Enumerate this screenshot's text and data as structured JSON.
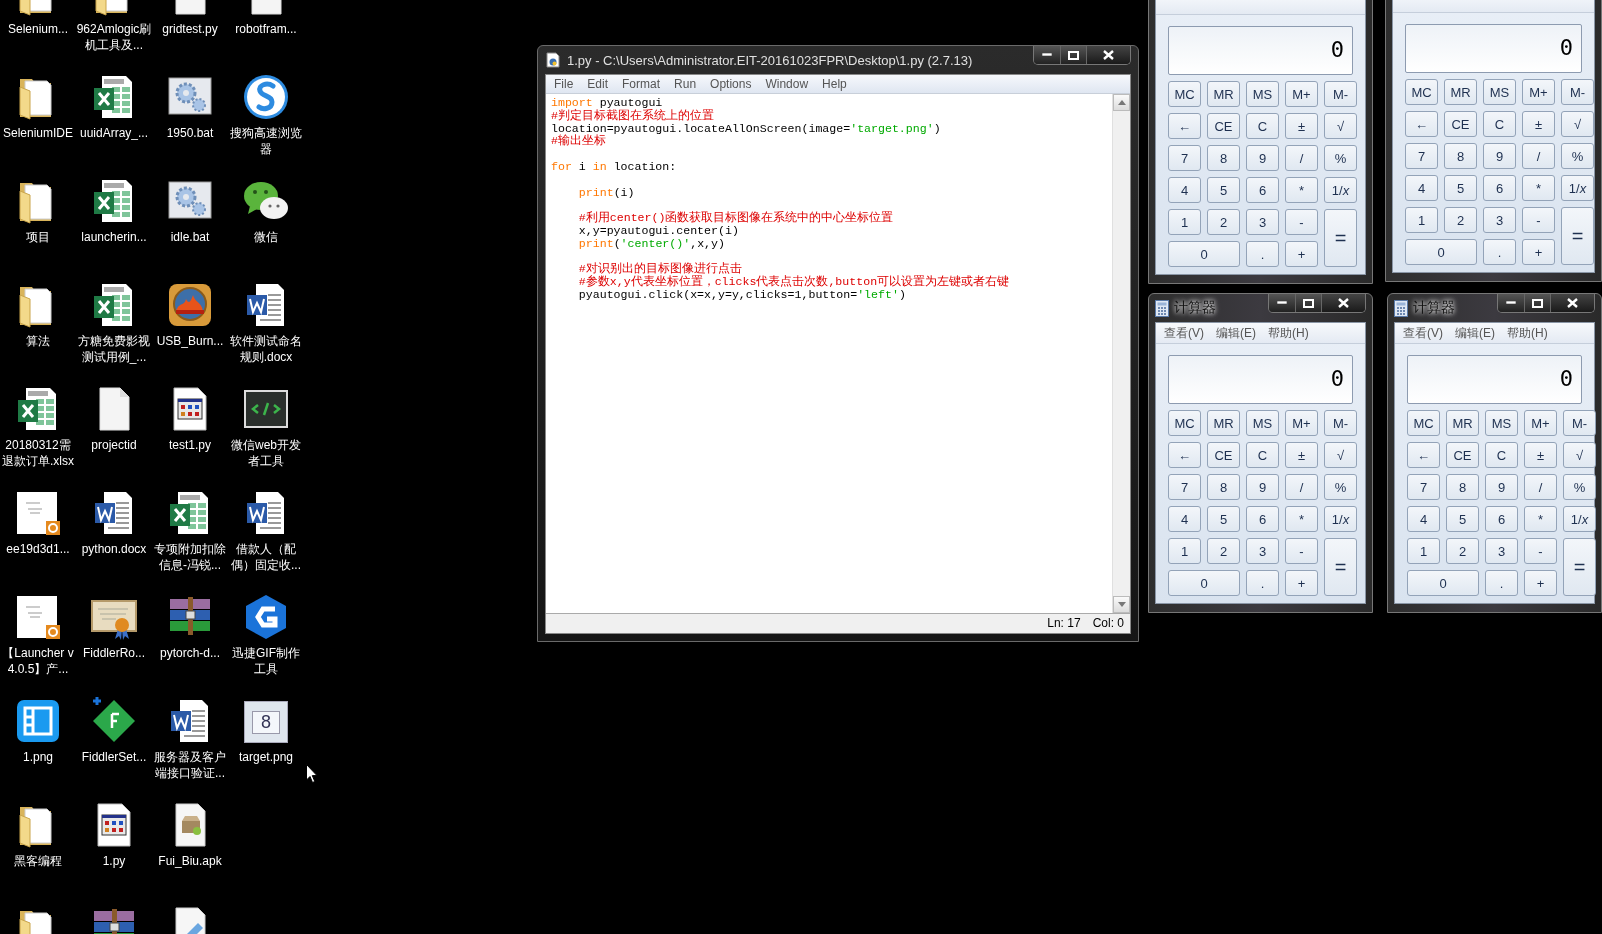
{
  "desktop_icons": [
    {
      "kind": "folder",
      "label": "Selenium..."
    },
    {
      "kind": "folder",
      "label": "SeleniumIDE"
    },
    {
      "kind": "folder",
      "label": "项目"
    },
    {
      "kind": "folder",
      "label": "算法"
    },
    {
      "kind": "spreadsheet",
      "label": "20180312需退款订单.xlsx"
    },
    {
      "kind": "pdfdoc",
      "label": "ee19d3d1..."
    },
    {
      "kind": "pdfdoc",
      "label": "【Launcher v4.0.5】产..."
    },
    {
      "kind": "film",
      "label": "1.png"
    },
    {
      "kind": "folder",
      "label": "黑客编程"
    },
    {
      "kind": "folder"
    },
    {
      "kind": "folder",
      "label": "962Amlogic刷机工具及..."
    },
    {
      "kind": "spreadsheet",
      "label": "uuidArray_..."
    },
    {
      "kind": "spreadsheet",
      "label": "launcherin..."
    },
    {
      "kind": "spreadsheet",
      "label": "方糖免费影视测试用例_..."
    },
    {
      "kind": "blank",
      "label": "projectid"
    },
    {
      "kind": "word",
      "label": "python.docx"
    },
    {
      "kind": "certificate",
      "label": "FiddlerRo..."
    },
    {
      "kind": "fiddler",
      "label": "FiddlerSet..."
    },
    {
      "kind": "script",
      "label": "1.py"
    },
    {
      "kind": "archive"
    },
    {
      "kind": "blank",
      "label": "gridtest.py"
    },
    {
      "kind": "batch",
      "label": "1950.bat"
    },
    {
      "kind": "batch",
      "label": "idle.bat"
    },
    {
      "kind": "usb",
      "label": "USB_Burn..."
    },
    {
      "kind": "script",
      "label": "test1.py"
    },
    {
      "kind": "spreadsheet",
      "label": "专项附加扣除信息-冯锐..."
    },
    {
      "kind": "archive",
      "label": "pytorch-d..."
    },
    {
      "kind": "word",
      "label": "服务器及客户端接口验证..."
    },
    {
      "kind": "apk",
      "label": "Fui_Biu.apk"
    },
    {
      "kind": "notepad"
    },
    {
      "kind": "blank",
      "label": "robotfram..."
    },
    {
      "kind": "browser",
      "label": "搜狗高速浏览器"
    },
    {
      "kind": "chat",
      "label": "微信"
    },
    {
      "kind": "word",
      "label": "软件测试命名规则.docx"
    },
    {
      "kind": "devtools",
      "label": "微信web开发者工具"
    },
    {
      "kind": "word",
      "label": "借款人（配偶）固定收..."
    },
    {
      "kind": "gifmaker",
      "label": "迅捷GIF制作工具"
    },
    {
      "kind": "thumbnail",
      "label": "target.png",
      "image_text": "8"
    }
  ],
  "editor_window": {
    "title": "1.py - C:\\Users\\Administrator.EIT-20161023FPR\\Desktop\\1.py (2.7.13)",
    "menu": [
      "File",
      "Edit",
      "Format",
      "Run",
      "Options",
      "Window",
      "Help"
    ],
    "code_lines": [
      {
        "kind": "code",
        "segments": [
          {
            "kind": "keyword",
            "text": "import"
          },
          {
            "kind": "plain",
            "text": " pyautogui"
          }
        ]
      },
      {
        "kind": "code",
        "segments": [
          {
            "kind": "comment",
            "text": "#判定目标截图在系统上的位置"
          }
        ]
      },
      {
        "kind": "code",
        "segments": [
          {
            "kind": "plain",
            "text": "location=pyautogui.locateAllOnScreen(image="
          },
          {
            "kind": "string",
            "text": "'target.png'"
          },
          {
            "kind": "plain",
            "text": ")"
          }
        ]
      },
      {
        "kind": "code",
        "segments": [
          {
            "kind": "comment",
            "text": "#输出坐标"
          }
        ]
      },
      {
        "kind": "blank"
      },
      {
        "kind": "code",
        "segments": [
          {
            "kind": "keyword",
            "text": "for"
          },
          {
            "kind": "plain",
            "text": " i "
          },
          {
            "kind": "keyword",
            "text": "in"
          },
          {
            "kind": "plain",
            "text": " location:"
          }
        ]
      },
      {
        "kind": "blank"
      },
      {
        "kind": "code",
        "indent": true,
        "segments": [
          {
            "kind": "keyword",
            "text": "print"
          },
          {
            "kind": "plain",
            "text": "(i)"
          }
        ]
      },
      {
        "kind": "blank"
      },
      {
        "kind": "code",
        "indent": true,
        "segments": [
          {
            "kind": "comment",
            "text": "#利用center()函数获取目标图像在系统中的中心坐标位置"
          }
        ]
      },
      {
        "kind": "code",
        "indent": true,
        "segments": [
          {
            "kind": "plain",
            "text": "x,y=pyautogui.center(i)"
          }
        ]
      },
      {
        "kind": "code",
        "indent": true,
        "segments": [
          {
            "kind": "keyword",
            "text": "print"
          },
          {
            "kind": "plain",
            "text": "("
          },
          {
            "kind": "string",
            "text": "'center()'"
          },
          {
            "kind": "plain",
            "text": ",x,y)"
          }
        ]
      },
      {
        "kind": "blank"
      },
      {
        "kind": "code",
        "indent": true,
        "segments": [
          {
            "kind": "comment",
            "text": "#对识别出的目标图像进行点击"
          }
        ]
      },
      {
        "kind": "code",
        "indent": true,
        "segments": [
          {
            "kind": "comment",
            "text": "#参数x,y代表坐标位置，clicks代表点击次数,button可以设置为左键或者右键"
          }
        ]
      },
      {
        "kind": "code",
        "indent": true,
        "segments": [
          {
            "kind": "plain",
            "text": "pyautogui.click(x=x,y=y,clicks=1,button="
          },
          {
            "kind": "string",
            "text": "'left'"
          },
          {
            "kind": "plain",
            "text": ")"
          }
        ]
      }
    ],
    "status_bar": {
      "line": "Ln: 17",
      "column": "Col: 0"
    }
  },
  "calculators": [
    {
      "display": "0",
      "keys": [
        {
          "kind": "key",
          "label": "MC"
        },
        {
          "kind": "key",
          "label": "MR"
        },
        {
          "kind": "key",
          "label": "MS"
        },
        {
          "kind": "key",
          "label": "M+"
        },
        {
          "kind": "key",
          "label": "M-"
        },
        {
          "kind": "key",
          "label": "←"
        },
        {
          "kind": "key",
          "label": "CE"
        },
        {
          "kind": "key",
          "label": "C"
        },
        {
          "kind": "key",
          "label": "±"
        },
        {
          "kind": "key",
          "label": "√"
        },
        {
          "kind": "key",
          "label": "7"
        },
        {
          "kind": "key",
          "label": "8"
        },
        {
          "kind": "key",
          "label": "9"
        },
        {
          "kind": "key",
          "label": "/"
        },
        {
          "kind": "key",
          "label": "%"
        },
        {
          "kind": "key",
          "label": "4"
        },
        {
          "kind": "key",
          "label": "5"
        },
        {
          "kind": "key",
          "label": "6"
        },
        {
          "kind": "key",
          "label": "*"
        },
        {
          "kind": "key",
          "label": "1/*x*"
        },
        {
          "kind": "key",
          "label": "1"
        },
        {
          "kind": "key",
          "label": "2"
        },
        {
          "kind": "key",
          "label": "3"
        },
        {
          "kind": "key",
          "label": "-"
        },
        {
          "kind": "tall",
          "label": "="
        },
        {
          "kind": "wide",
          "label": "0"
        },
        {
          "kind": "key",
          "label": "."
        },
        {
          "kind": "key",
          "label": "+"
        }
      ]
    },
    {
      "display": "0",
      "keys": [
        {
          "kind": "key",
          "label": "MC"
        },
        {
          "kind": "key",
          "label": "MR"
        },
        {
          "kind": "key",
          "label": "MS"
        },
        {
          "kind": "key",
          "label": "M+"
        },
        {
          "kind": "key",
          "label": "M-"
        },
        {
          "kind": "key",
          "label": "←"
        },
        {
          "kind": "key",
          "label": "CE"
        },
        {
          "kind": "key",
          "label": "C"
        },
        {
          "kind": "key",
          "label": "±"
        },
        {
          "kind": "key",
          "label": "√"
        },
        {
          "kind": "key",
          "label": "7"
        },
        {
          "kind": "key",
          "label": "8"
        },
        {
          "kind": "key",
          "label": "9"
        },
        {
          "kind": "key",
          "label": "/"
        },
        {
          "kind": "key",
          "label": "%"
        },
        {
          "kind": "key",
          "label": "4"
        },
        {
          "kind": "key",
          "label": "5"
        },
        {
          "kind": "key",
          "label": "6"
        },
        {
          "kind": "key",
          "label": "*"
        },
        {
          "kind": "key",
          "label": "1/*x*"
        },
        {
          "kind": "key",
          "label": "1"
        },
        {
          "kind": "key",
          "label": "2"
        },
        {
          "kind": "key",
          "label": "3"
        },
        {
          "kind": "key",
          "label": "-"
        },
        {
          "kind": "tall",
          "label": "="
        },
        {
          "kind": "wide",
          "label": "0"
        },
        {
          "kind": "key",
          "label": "."
        },
        {
          "kind": "key",
          "label": "+"
        }
      ]
    },
    {
      "title": "计算器",
      "menu": [
        "查看(V)",
        "编辑(E)",
        "帮助(H)"
      ],
      "display": "0",
      "keys": [
        {
          "kind": "key",
          "label": "MC"
        },
        {
          "kind": "key",
          "label": "MR"
        },
        {
          "kind": "key",
          "label": "MS"
        },
        {
          "kind": "key",
          "label": "M+"
        },
        {
          "kind": "key",
          "label": "M-"
        },
        {
          "kind": "key",
          "label": "←"
        },
        {
          "kind": "key",
          "label": "CE"
        },
        {
          "kind": "key",
          "label": "C"
        },
        {
          "kind": "key",
          "label": "±"
        },
        {
          "kind": "key",
          "label": "√"
        },
        {
          "kind": "key",
          "label": "7"
        },
        {
          "kind": "key",
          "label": "8"
        },
        {
          "kind": "key",
          "label": "9"
        },
        {
          "kind": "key",
          "label": "/"
        },
        {
          "kind": "key",
          "label": "%"
        },
        {
          "kind": "key",
          "label": "4"
        },
        {
          "kind": "key",
          "label": "5"
        },
        {
          "kind": "key",
          "label": "6"
        },
        {
          "kind": "key",
          "label": "*"
        },
        {
          "kind": "key",
          "label": "1/*x*"
        },
        {
          "kind": "key",
          "label": "1"
        },
        {
          "kind": "key",
          "label": "2"
        },
        {
          "kind": "key",
          "label": "3"
        },
        {
          "kind": "key",
          "label": "-"
        },
        {
          "kind": "tall",
          "label": "="
        },
        {
          "kind": "wide",
          "label": "0"
        },
        {
          "kind": "key",
          "label": "."
        },
        {
          "kind": "key",
          "label": "+"
        }
      ]
    },
    {
      "title": "计算器",
      "menu": [
        "查看(V)",
        "编辑(E)",
        "帮助(H)"
      ],
      "display": "0",
      "keys": [
        {
          "kind": "key",
          "label": "MC"
        },
        {
          "kind": "key",
          "label": "MR"
        },
        {
          "kind": "key",
          "label": "MS"
        },
        {
          "kind": "key",
          "label": "M+"
        },
        {
          "kind": "key",
          "label": "M-"
        },
        {
          "kind": "key",
          "label": "←"
        },
        {
          "kind": "key",
          "label": "CE"
        },
        {
          "kind": "key",
          "label": "C"
        },
        {
          "kind": "key",
          "label": "±"
        },
        {
          "kind": "key",
          "label": "√"
        },
        {
          "kind": "key",
          "label": "7"
        },
        {
          "kind": "key",
          "label": "8"
        },
        {
          "kind": "key",
          "label": "9"
        },
        {
          "kind": "key",
          "label": "/"
        },
        {
          "kind": "key",
          "label": "%"
        },
        {
          "kind": "key",
          "label": "4"
        },
        {
          "kind": "key",
          "label": "5"
        },
        {
          "kind": "key",
          "label": "6"
        },
        {
          "kind": "key",
          "label": "*"
        },
        {
          "kind": "key",
          "label": "1/*x*"
        },
        {
          "kind": "key",
          "label": "1"
        },
        {
          "kind": "key",
          "label": "2"
        },
        {
          "kind": "key",
          "label": "3"
        },
        {
          "kind": "key",
          "label": "-"
        },
        {
          "kind": "tall",
          "label": "="
        },
        {
          "kind": "wide",
          "label": "0"
        },
        {
          "kind": "key",
          "label": "."
        },
        {
          "kind": "key",
          "label": "+"
        }
      ]
    }
  ]
}
